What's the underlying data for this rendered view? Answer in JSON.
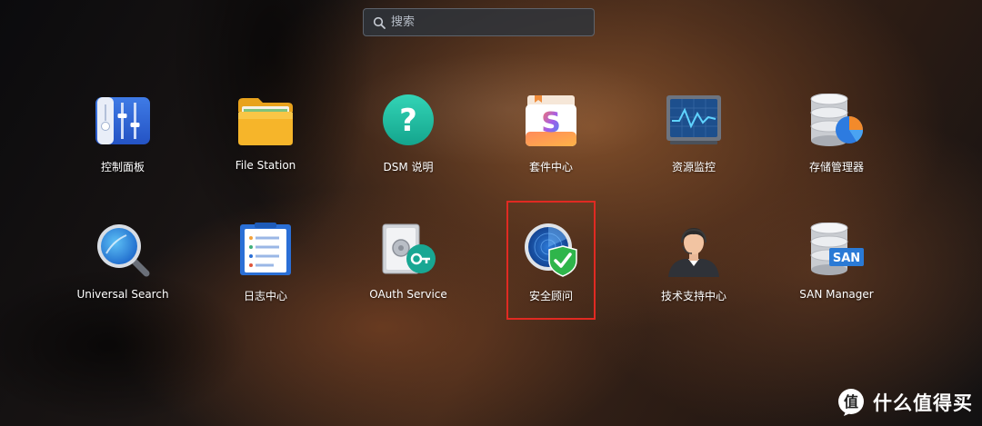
{
  "search": {
    "placeholder": "搜索",
    "icon": "search-icon"
  },
  "apps": [
    {
      "label": "控制面板",
      "icon": "control-panel-icon"
    },
    {
      "label": "File Station",
      "icon": "folder-icon"
    },
    {
      "label": "DSM 说明",
      "icon": "help-icon"
    },
    {
      "label": "套件中心",
      "icon": "package-center-icon"
    },
    {
      "label": "资源监控",
      "icon": "resource-monitor-icon"
    },
    {
      "label": "存储管理器",
      "icon": "storage-manager-icon"
    },
    {
      "label": "Universal Search",
      "icon": "universal-search-icon"
    },
    {
      "label": "日志中心",
      "icon": "log-center-icon"
    },
    {
      "label": "OAuth Service",
      "icon": "oauth-service-icon"
    },
    {
      "label": "安全顾问",
      "icon": "security-advisor-icon"
    },
    {
      "label": "技术支持中心",
      "icon": "support-center-icon"
    },
    {
      "label": "SAN Manager",
      "icon": "san-manager-icon"
    }
  ],
  "highlight_color": "#e02a22",
  "watermark": {
    "text": "什么值得买",
    "badge": "值"
  }
}
